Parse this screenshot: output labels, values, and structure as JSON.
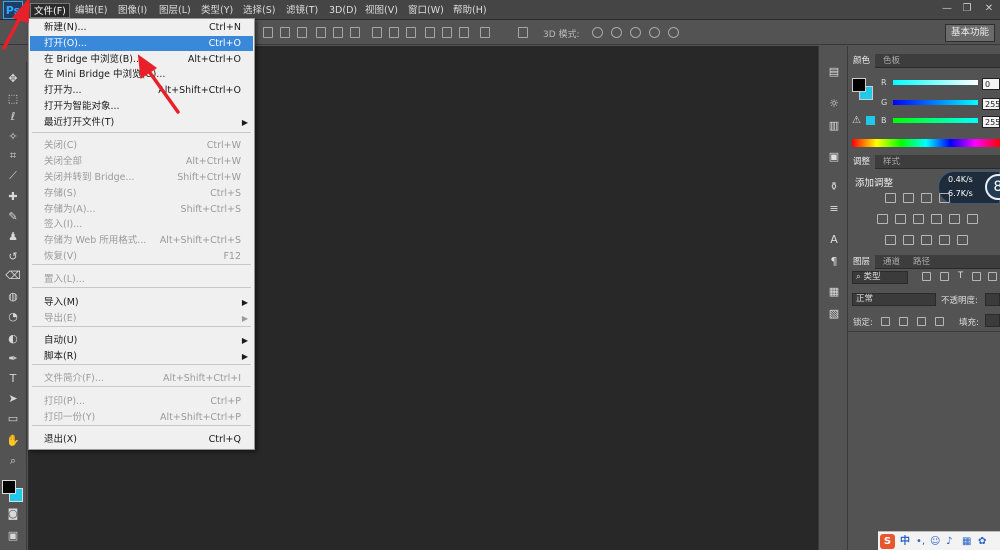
{
  "app": {
    "logo": "Ps"
  },
  "menubar": {
    "items": [
      "文件(F)",
      "编辑(E)",
      "图像(I)",
      "图层(L)",
      "类型(Y)",
      "选择(S)",
      "滤镜(T)",
      "3D(D)",
      "视图(V)",
      "窗口(W)",
      "帮助(H)"
    ],
    "active_index": 0
  },
  "window_controls": {
    "minimize": "—",
    "restore": "❐",
    "close": "✕"
  },
  "options_bar": {
    "mode_label": "3D 模式:",
    "workspace_button": "基本功能"
  },
  "file_menu": {
    "items": [
      {
        "label": "新建(N)...",
        "shortcut": "Ctrl+N",
        "enabled": true
      },
      {
        "label": "打开(O)...",
        "shortcut": "Ctrl+O",
        "enabled": true,
        "highlighted": true
      },
      {
        "label": "在 Bridge 中浏览(B)...",
        "shortcut": "Alt+Ctrl+O",
        "enabled": true
      },
      {
        "label": "在 Mini Bridge 中浏览(G)...",
        "shortcut": "",
        "enabled": true
      },
      {
        "label": "打开为...",
        "shortcut": "Alt+Shift+Ctrl+O",
        "enabled": true
      },
      {
        "label": "打开为智能对象...",
        "shortcut": "",
        "enabled": true
      },
      {
        "label": "最近打开文件(T)",
        "shortcut": "",
        "enabled": true,
        "submenu": true
      },
      {
        "label": "关闭(C)",
        "shortcut": "Ctrl+W",
        "enabled": false
      },
      {
        "label": "关闭全部",
        "shortcut": "Alt+Ctrl+W",
        "enabled": false
      },
      {
        "label": "关闭并转到 Bridge...",
        "shortcut": "Shift+Ctrl+W",
        "enabled": false
      },
      {
        "label": "存储(S)",
        "shortcut": "Ctrl+S",
        "enabled": false
      },
      {
        "label": "存储为(A)...",
        "shortcut": "Shift+Ctrl+S",
        "enabled": false
      },
      {
        "label": "签入(I)...",
        "shortcut": "",
        "enabled": false
      },
      {
        "label": "存储为 Web 所用格式...",
        "shortcut": "Alt+Shift+Ctrl+S",
        "enabled": false
      },
      {
        "label": "恢复(V)",
        "shortcut": "F12",
        "enabled": false
      },
      {
        "label": "置入(L)...",
        "shortcut": "",
        "enabled": false
      },
      {
        "label": "导入(M)",
        "shortcut": "",
        "enabled": true,
        "submenu": true
      },
      {
        "label": "导出(E)",
        "shortcut": "",
        "enabled": false,
        "submenu": true
      },
      {
        "label": "自动(U)",
        "shortcut": "",
        "enabled": true,
        "submenu": true
      },
      {
        "label": "脚本(R)",
        "shortcut": "",
        "enabled": true,
        "submenu": true
      },
      {
        "label": "文件简介(F)...",
        "shortcut": "Alt+Shift+Ctrl+I",
        "enabled": false
      },
      {
        "label": "打印(P)...",
        "shortcut": "Ctrl+P",
        "enabled": false
      },
      {
        "label": "打印一份(Y)",
        "shortcut": "Alt+Shift+Ctrl+P",
        "enabled": false
      },
      {
        "label": "退出(X)",
        "shortcut": "Ctrl+Q",
        "enabled": true
      }
    ]
  },
  "tools": [
    "move-tool",
    "marquee-tool",
    "lasso-tool",
    "magic-wand-tool",
    "crop-tool",
    "eyedropper-tool",
    "healing-brush-tool",
    "brush-tool",
    "clone-stamp-tool",
    "history-brush-tool",
    "eraser-tool",
    "paint-bucket-tool",
    "blur-tool",
    "dodge-tool",
    "pen-tool",
    "type-tool",
    "path-selection-tool",
    "rectangle-tool",
    "hand-tool",
    "zoom-tool"
  ],
  "colors": {
    "foreground": "#000000",
    "background": "#1fc9ea",
    "accent": "#3a88d9"
  },
  "color_panel": {
    "tabs": [
      "颜色",
      "色板"
    ],
    "r_label": "R",
    "r_value": "0",
    "g_label": "G",
    "g_value": "255",
    "b_label": "B",
    "b_value": "255"
  },
  "adjust_panel": {
    "tabs": [
      "调整",
      "样式"
    ],
    "title": "添加调整"
  },
  "network_widget": {
    "up": "0.4K/s",
    "down": "6.7K/s",
    "badge": "8"
  },
  "layers_panel": {
    "tabs": [
      "图层",
      "通道",
      "路径"
    ],
    "filter_kind": "类型",
    "blend_mode": "正常",
    "opacity_label": "不透明度:",
    "lock_label": "锁定:",
    "fill_label": "填充:"
  },
  "ime": {
    "logo": "S",
    "lang": "中"
  }
}
